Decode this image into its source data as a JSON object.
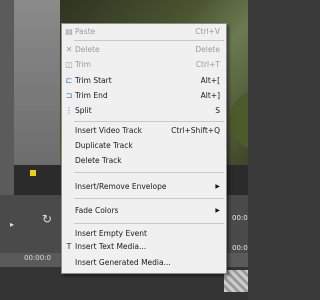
{
  "background": {
    "timecode_a": "00:0",
    "timecode_b": "00:0",
    "timecode_ruler": "00:00:0"
  },
  "menu": {
    "items": [
      {
        "label": "Paste",
        "shortcut": "Ctrl+V",
        "icon": "paste-icon",
        "enabled": false
      },
      {
        "label": "Delete",
        "shortcut": "Delete",
        "icon": "delete-icon",
        "enabled": false
      },
      {
        "label": "Trim",
        "shortcut": "Ctrl+T",
        "icon": "trim-icon",
        "enabled": false
      },
      {
        "label": "Trim Start",
        "shortcut": "Alt+[",
        "icon": "trim-start-icon",
        "enabled": true
      },
      {
        "label": "Trim End",
        "shortcut": "Alt+]",
        "icon": "trim-end-icon",
        "enabled": true
      },
      {
        "label": "Split",
        "shortcut": "S",
        "icon": "split-icon",
        "enabled": true
      },
      {
        "label": "Insert Video Track",
        "shortcut": "Ctrl+Shift+Q",
        "icon": "",
        "enabled": true
      },
      {
        "label": "Duplicate Track",
        "shortcut": "",
        "icon": "",
        "enabled": true
      },
      {
        "label": "Delete Track",
        "shortcut": "",
        "icon": "",
        "enabled": true
      },
      {
        "label": "Insert/Remove Envelope",
        "shortcut": "",
        "icon": "",
        "enabled": true
      },
      {
        "label": "Fade Colors",
        "shortcut": "",
        "icon": "",
        "enabled": true
      },
      {
        "label": "Insert Empty Event",
        "shortcut": "",
        "icon": "",
        "enabled": true
      },
      {
        "label": "Insert Text Media...",
        "shortcut": "",
        "icon": "text-media-icon",
        "enabled": true
      },
      {
        "label": "Insert Generated Media...",
        "shortcut": "",
        "icon": "",
        "enabled": true
      }
    ]
  }
}
